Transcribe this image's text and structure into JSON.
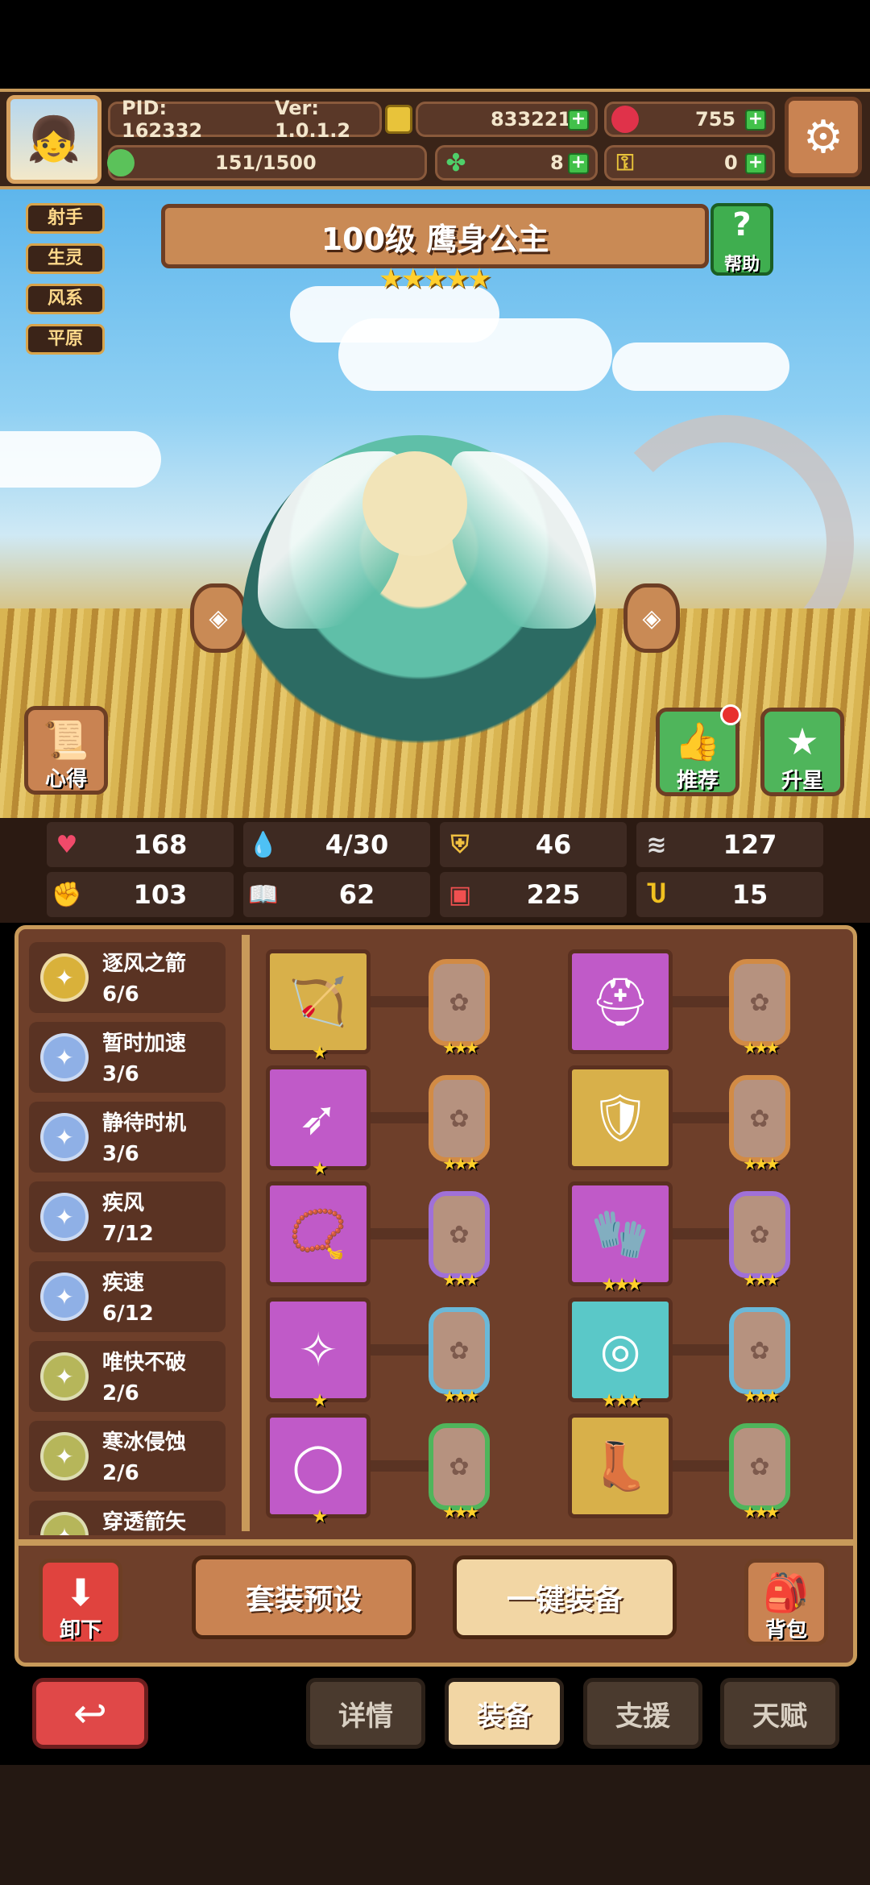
{
  "header": {
    "pid": "PID: 162332",
    "version": "Ver: 1.0.1.2",
    "gold": "833221",
    "gems": "755",
    "stamina": "151/1500",
    "clover": "8",
    "key": "0"
  },
  "tags": [
    "射手",
    "生灵",
    "风系",
    "平原"
  ],
  "hero": {
    "title": "100级 鹰身公主",
    "stars": "★★★★★",
    "help_label": "帮助"
  },
  "side_buttons": {
    "insight": "心得",
    "recommend": "推荐",
    "star_up": "升星"
  },
  "stats": [
    {
      "icon": "heart-icon",
      "value": "168"
    },
    {
      "icon": "water-drop-icon",
      "value": "4/30"
    },
    {
      "icon": "shield-icon",
      "value": "46"
    },
    {
      "icon": "wing-icon",
      "value": "127"
    },
    {
      "icon": "fist-icon",
      "value": "103"
    },
    {
      "icon": "book-icon",
      "value": "62"
    },
    {
      "icon": "boot-icon",
      "value": "225"
    },
    {
      "icon": "magnet-icon",
      "value": "15"
    }
  ],
  "skills": [
    {
      "name": "逐风之箭",
      "progress": "6/6",
      "color": "#d9b13a"
    },
    {
      "name": "暂时加速",
      "progress": "3/6",
      "color": "#8fb0e6"
    },
    {
      "name": "静待时机",
      "progress": "3/6",
      "color": "#8fb0e6"
    },
    {
      "name": "疾风",
      "progress": "7/12",
      "color": "#8fb0e6"
    },
    {
      "name": "疾速",
      "progress": "6/12",
      "color": "#8fb0e6"
    },
    {
      "name": "唯快不破",
      "progress": "2/6",
      "color": "#b6b65a"
    },
    {
      "name": "寒冰侵蚀",
      "progress": "2/6",
      "color": "#b6b65a"
    },
    {
      "name": "穿透箭矢",
      "progress": "",
      "color": "#b6b65a"
    }
  ],
  "equipment_icons": [
    "bow-icon",
    "helmet-icon",
    "arrow-icon",
    "armor-icon",
    "necklace-icon",
    "gauntlet-icon",
    "gem-icon",
    "belt-icon",
    "ring-icon",
    "boots-icon"
  ],
  "buttons": {
    "unequip": "卸下",
    "preset": "套装预设",
    "auto_equip": "一键装备",
    "bag": "背包"
  },
  "nav": {
    "details": "详情",
    "equip": "装备",
    "support": "支援",
    "talent": "天赋"
  }
}
